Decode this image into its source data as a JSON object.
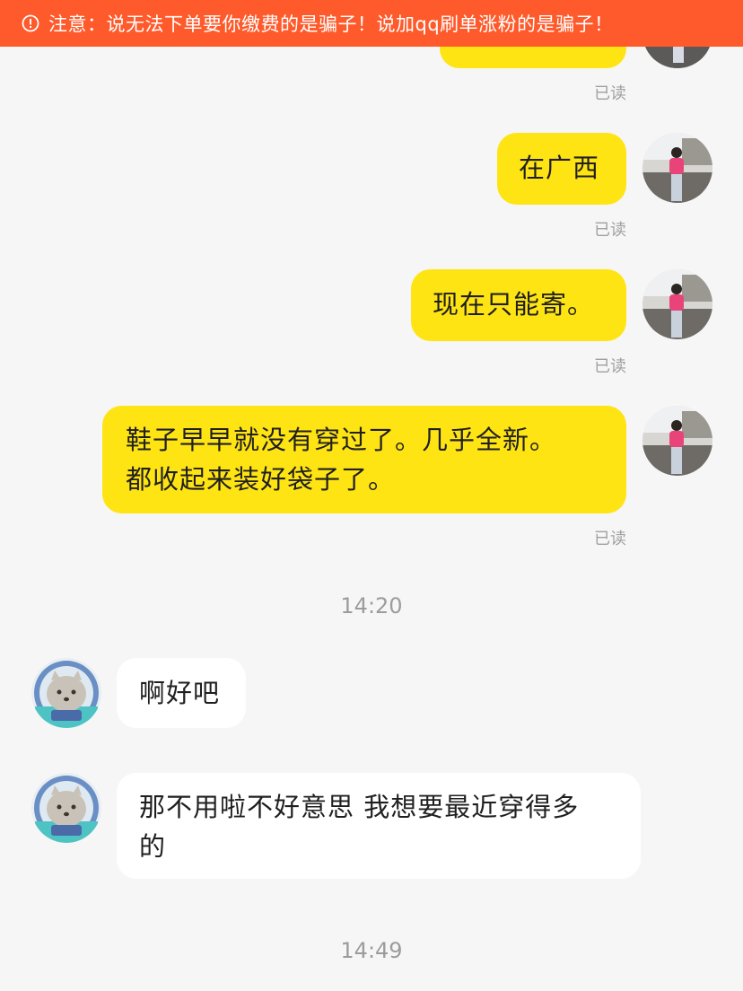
{
  "notice": {
    "icon": "alert-circle-icon",
    "text": "注意：说无法下单要你缴费的是骗子！说加qq刷单涨粉的是骗子！"
  },
  "read_label": "已读",
  "messages": [
    {
      "from": "me",
      "text": "在广西",
      "read": "已读"
    },
    {
      "from": "me",
      "text": "现在只能寄。",
      "read": "已读"
    },
    {
      "from": "me",
      "line1": "鞋子早早就没有穿过了。几乎全新。",
      "line2": "都收起来装好袋子了。",
      "read": "已读"
    },
    {
      "from": "them",
      "text": "啊好吧"
    },
    {
      "from": "them",
      "line1": "那不用啦不好意思 我想要最近穿得多",
      "line2": "的"
    }
  ],
  "timestamps": [
    "14:20",
    "14:49"
  ],
  "colors": {
    "notice_bg": "#fe5a2b",
    "my_bubble": "#ffe414",
    "their_bubble": "#ffffff",
    "background": "#f6f6f6"
  }
}
